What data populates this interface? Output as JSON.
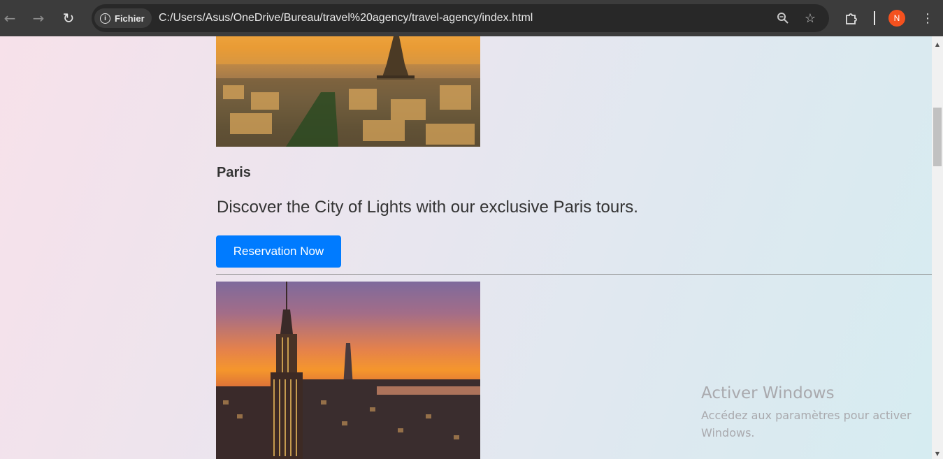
{
  "browser": {
    "site_chip_label": "Fichier",
    "url": "C:/Users/Asus/OneDrive/Bureau/travel%20agency/travel-agency/index.html",
    "profile_initial": "N",
    "icons": {
      "back": "arrow-left-icon",
      "forward": "arrow-right-icon",
      "reload": "reload-icon",
      "info": "info-icon",
      "zoom": "zoom-icon",
      "bookmark": "star-icon",
      "extensions": "puzzle-icon",
      "menu": "kebab-menu-icon"
    }
  },
  "destinations": [
    {
      "name": "Paris",
      "description": "Discover the City of Lights with our exclusive Paris tours.",
      "button_label": "Reservation Now",
      "image": "paris-eiffel-tower-sunset"
    },
    {
      "image": "new-york-empire-state-sunset"
    }
  ],
  "windows_watermark": {
    "title": "Activer Windows",
    "subtitle": "Accédez aux paramètres pour activer Windows."
  },
  "colors": {
    "button": "#007bff",
    "browser_chrome": "#3c3c3c",
    "avatar": "#f4511e"
  }
}
